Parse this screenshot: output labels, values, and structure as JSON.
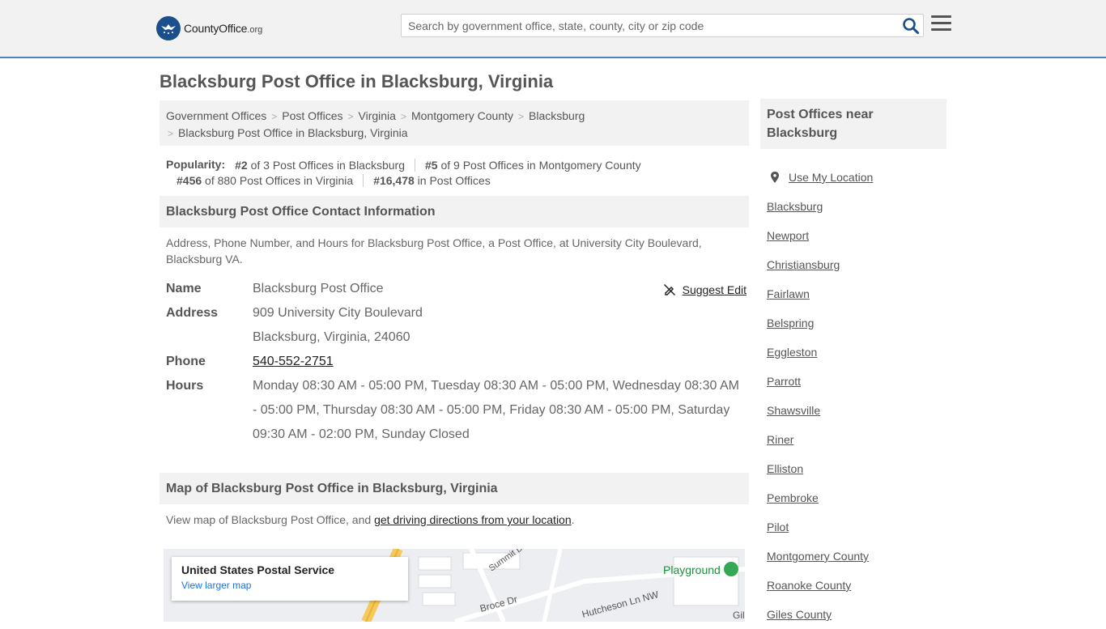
{
  "header": {
    "logo_brand": "CountyOffice",
    "logo_tld": ".org",
    "search_placeholder": "Search by government office, state, county, city or zip code"
  },
  "page_title": "Blacksburg Post Office in Blacksburg, Virginia",
  "breadcrumb": {
    "items": [
      "Government Offices",
      "Post Offices",
      "Virginia",
      "Montgomery County",
      "Blacksburg"
    ],
    "current": "Blacksburg Post Office in Blacksburg, Virginia"
  },
  "popularity": {
    "label": "Popularity:",
    "items": [
      {
        "rank": "#2",
        "text": " of 3 Post Offices in Blacksburg"
      },
      {
        "rank": "#5",
        "text": " of 9 Post Offices in Montgomery County"
      },
      {
        "rank": "#456",
        "text": " of 880 Post Offices in Virginia"
      },
      {
        "rank": "#16,478",
        "text": " in Post Offices"
      }
    ]
  },
  "contact": {
    "heading": "Blacksburg Post Office Contact Information",
    "description": "Address, Phone Number, and Hours for Blacksburg Post Office, a Post Office, at University City Boulevard, Blacksburg VA.",
    "suggest_edit": "Suggest Edit",
    "name_label": "Name",
    "name": "Blacksburg Post Office",
    "address_label": "Address",
    "address_line1": "909 University City Boulevard",
    "address_line2": "Blacksburg, Virginia, 24060",
    "phone_label": "Phone",
    "phone": "540-552-2751",
    "hours_label": "Hours",
    "hours": "Monday 08:30 AM - 05:00 PM, Tuesday 08:30 AM - 05:00 PM, Wednesday 08:30 AM - 05:00 PM, Thursday 08:30 AM - 05:00 PM, Friday 08:30 AM - 05:00 PM, Saturday 09:30 AM - 02:00 PM, Sunday Closed"
  },
  "map_section": {
    "heading": "Map of Blacksburg Post Office in Blacksburg, Virginia",
    "desc_prefix": "View map of Blacksburg Post Office, and ",
    "desc_link": "get driving directions from your location",
    "desc_suffix": ".",
    "card_title": "United States Postal Service",
    "card_link": "View larger map",
    "labels": [
      "Summit Dr",
      "Playground",
      "Broce Dr",
      "Hutcheson Ln NW",
      "Gil"
    ]
  },
  "sidebar": {
    "heading": "Post Offices near Blacksburg",
    "use_location": "Use My Location",
    "items": [
      "Blacksburg",
      "Newport",
      "Christiansburg",
      "Fairlawn",
      "Belspring",
      "Eggleston",
      "Parrott",
      "Shawsville",
      "Riner",
      "Elliston",
      "Pembroke",
      "Pilot",
      "Montgomery County",
      "Roanoke County",
      "Giles County"
    ]
  },
  "colors": {
    "accent_border": "#4a86c5",
    "logo_blue": "#1a4f8b",
    "search_icon": "#1a4f8b"
  }
}
